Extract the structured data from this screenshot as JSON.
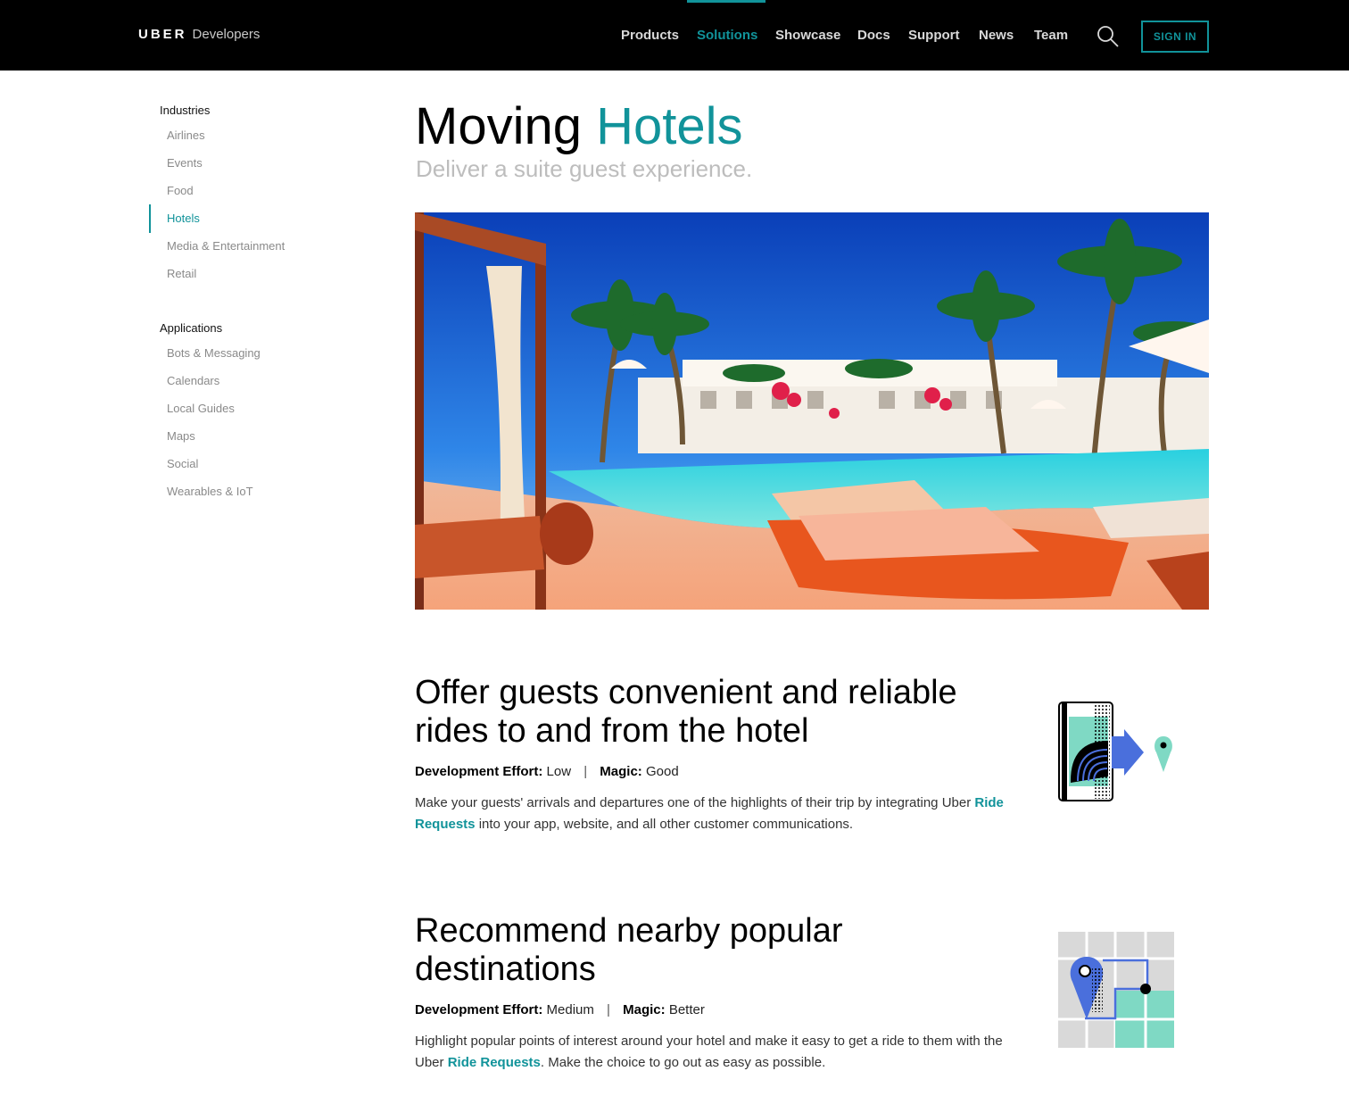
{
  "header": {
    "brand": "UBER",
    "brand_sub": "Developers",
    "nav": [
      {
        "label": "Products"
      },
      {
        "label": "Solutions"
      },
      {
        "label": "Showcase"
      },
      {
        "label": "Docs"
      },
      {
        "label": "Support"
      },
      {
        "label": "News"
      },
      {
        "label": "Team"
      }
    ],
    "active_nav": "Solutions",
    "sign_in": "SIGN IN",
    "accent_color": "#11939a"
  },
  "sidebar": {
    "groups": [
      {
        "heading": "Industries",
        "items": [
          "Airlines",
          "Events",
          "Food",
          "Hotels",
          "Media & Entertainment",
          "Retail"
        ]
      },
      {
        "heading": "Applications",
        "items": [
          "Bots & Messaging",
          "Calendars",
          "Local Guides",
          "Maps",
          "Social",
          "Wearables & IoT"
        ]
      }
    ],
    "active_item": "Hotels"
  },
  "main": {
    "title_prefix": "Moving",
    "title_accent": "Hotels",
    "subtitle": "Deliver a suite guest experience.",
    "hero_image": "hotel-pool-photo",
    "sections": [
      {
        "title": "Offer guests convenient and reliable rides to and from the hotel",
        "effort_label": "Development Effort:",
        "effort_value": "Low",
        "magic_label": "Magic:",
        "magic_value": "Good",
        "desc_before": "Make your guests' arrivals and departures one of the highlights of their trip by integrating Uber",
        "link": "Ride Requests",
        "desc_after": "into your app, website, and all other customer communications.",
        "icon": "phone-ride-request-icon"
      },
      {
        "title": "Recommend nearby popular destinations",
        "effort_label": "Development Effort:",
        "effort_value": "Medium",
        "magic_label": "Magic:",
        "magic_value": "Better",
        "desc_before": "Highlight popular points of interest around your hotel and make it easy to get a ride to them with the Uber",
        "link": "Ride Requests",
        "desc_after": ". Make the choice to go out as easy as possible.",
        "icon": "map-destinations-icon"
      }
    ]
  }
}
